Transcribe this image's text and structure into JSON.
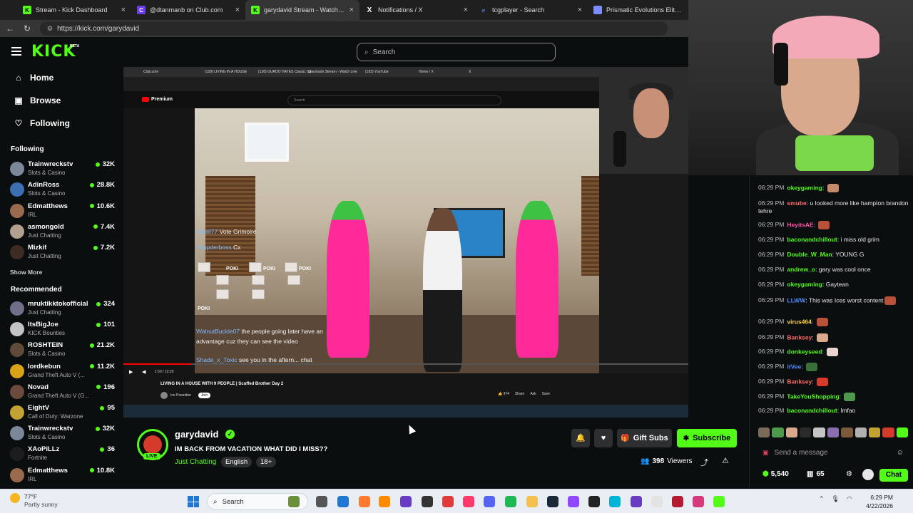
{
  "browser": {
    "tabs": [
      {
        "label": "Stream - Kick Dashboard",
        "icon": "kick-icon",
        "color": "#53fc18",
        "active": false
      },
      {
        "label": "@dtanmanb on Club.com",
        "icon": "club-icon",
        "color": "#6b3cf2",
        "active": false
      },
      {
        "label": "garydavid Stream - Watch Live on",
        "icon": "kick-icon",
        "color": "#53fc18",
        "active": true
      },
      {
        "label": "Notifications / X",
        "icon": "x-icon",
        "color": "#ffffff",
        "active": false
      },
      {
        "label": "tcgplayer - Search",
        "icon": "search-icon",
        "color": "#4f8cff",
        "active": false
      },
      {
        "label": "Prismatic Evolutions Elite Trainer B",
        "icon": "store-icon",
        "color": "#7a8cff",
        "active": false
      }
    ],
    "url": "https://kick.com/garydavid"
  },
  "kick": {
    "logo": "KICK",
    "beta": "BETA",
    "search_placeholder": "Search"
  },
  "sidebar": {
    "nav": [
      {
        "label": "Home",
        "icon": "home-icon"
      },
      {
        "label": "Browse",
        "icon": "browse-icon"
      },
      {
        "label": "Following",
        "icon": "heart-icon"
      }
    ],
    "following_heading": "Following",
    "following": [
      {
        "name": "Trainwreckstv",
        "category": "Slots & Casino",
        "viewers": "32K",
        "color": "#7a8899"
      },
      {
        "name": "AdinRoss",
        "category": "Slots & Casino",
        "viewers": "28.8K",
        "color": "#3b6fb0"
      },
      {
        "name": "Edmatthews",
        "category": "IRL",
        "viewers": "10.6K",
        "color": "#9a6a4e"
      },
      {
        "name": "asmongold",
        "category": "Just Chatting",
        "viewers": "7.4K",
        "color": "#b2a18c"
      },
      {
        "name": "Mizkif",
        "category": "Just Chatting",
        "viewers": "7.2K",
        "color": "#3e2b24"
      }
    ],
    "show_more": "Show More",
    "recommended_heading": "Recommended",
    "recommended": [
      {
        "name": "mruktikktokofficial",
        "category": "Just Chatting",
        "viewers": "324",
        "color": "#6f6f8a"
      },
      {
        "name": "ItsBigJoe",
        "category": "KICK Bounties",
        "viewers": "101",
        "color": "#c4c4c4"
      },
      {
        "name": "ROSHTEIN",
        "category": "Slots & Casino",
        "viewers": "21.2K",
        "color": "#5f4a3a"
      },
      {
        "name": "lordkebun",
        "category": "Grand Theft Auto V (...",
        "viewers": "11.2K",
        "color": "#d8a317"
      },
      {
        "name": "Novad",
        "category": "Grand Theft Auto V (G...",
        "viewers": "196",
        "color": "#6a4b3c"
      },
      {
        "name": "EightV",
        "category": "Call of Duty: Warzone",
        "viewers": "95",
        "color": "#c2a233"
      },
      {
        "name": "Trainwreckstv",
        "category": "Slots & Casino",
        "viewers": "32K",
        "color": "#7a8899"
      },
      {
        "name": "XAoPiLLz",
        "category": "Fortnite",
        "viewers": "36",
        "color": "#1d1d1d"
      },
      {
        "name": "Edmatthews",
        "category": "IRL",
        "viewers": "10.8K",
        "color": "#9a6a4e"
      }
    ]
  },
  "video": {
    "inner_tabs": [
      "Club.com",
      "(128) LIVING IN A HOUSE",
      "(128) GURDO HATES Classic Cy",
      "dtanmanb Stream - Watch Live",
      "(193) YouTube",
      "Home / X",
      "X"
    ],
    "yt_logo": "Premium",
    "yt_search": "Search",
    "overlay_chat": [
      {
        "user": "Kahlil77",
        "text": "Vote Grimoire"
      },
      {
        "user": "Asapderboss",
        "text": "Cx"
      },
      {
        "user": "WalnutBuckle07",
        "text": "the people going later have an"
      },
      {
        "user": "",
        "text": "advantage cuz they can see the video"
      },
      {
        "user": "Shade_x_Toxic",
        "text": "see you in the aftern... chat"
      }
    ],
    "poki_label": "POKI",
    "time_display": "1:59 / 13:29",
    "yt_title": "LIVING IN A HOUSE WITH 9 PEOPLE | Scuffed Brother Day 2",
    "yt_channel": "Ice Poseidon",
    "yt_join": "Join",
    "yt_likes": "974",
    "yt_share": "Share",
    "yt_ask": "Ask",
    "yt_save": "Save",
    "progress_fraction": 0.12
  },
  "stream": {
    "streamer": "garydavid",
    "live": "LIVE",
    "title": "IM BACK FROM VACATION WHAT DID I MISS??",
    "category": "Just Chatting",
    "tags": [
      "English",
      "18+"
    ],
    "gift_label": "Gift Subs",
    "subscribe_label": "Subscribe",
    "viewers": "398",
    "viewers_label": "Viewers"
  },
  "chat": {
    "messages": [
      {
        "time": "06:29 PM",
        "user": "okeygaming",
        "user_color": "#53fc18",
        "text": "",
        "emote_color": "#c48a6a"
      },
      {
        "time": "06:29 PM",
        "user": "smube",
        "user_color": "#ff6b6b",
        "text": "u looked more like hampton brandon tehre",
        "emote_color": ""
      },
      {
        "time": "06:29 PM",
        "user": "HeyitsAE",
        "user_color": "#ff4fa3",
        "text": "",
        "emote_color": "#b8513a"
      },
      {
        "time": "06:29 PM",
        "user": "baconandchillout",
        "user_color": "#53fc18",
        "text": "i miss old grim",
        "emote_color": ""
      },
      {
        "time": "06:29 PM",
        "user": "Double_W_Man",
        "user_color": "#53fc18",
        "text": "YOUNG G",
        "emote_color": ""
      },
      {
        "time": "06:29 PM",
        "user": "andrew_o",
        "user_color": "#53fc18",
        "text": "gary was cool once",
        "emote_color": ""
      },
      {
        "time": "06:29 PM",
        "user": "okeygaming",
        "user_color": "#53fc18",
        "text": "Gaytean",
        "emote_color": ""
      },
      {
        "time": "06:29 PM",
        "user": "LLWW",
        "user_color": "#4f8cff",
        "text": "This was Ices worst content",
        "emote_color": "#b8513a"
      },
      {
        "time": "06:29 PM",
        "user": "virus464",
        "user_color": "#ffd23f",
        "text": "",
        "emote_color": "#b8513a"
      },
      {
        "time": "06:29 PM",
        "user": "Banksey",
        "user_color": "#ff6b6b",
        "text": "",
        "emote_color": "#d9a98e"
      },
      {
        "time": "06:29 PM",
        "user": "donkeyseed",
        "user_color": "#53fc18",
        "text": "",
        "emote_color": "#e9d4cf"
      },
      {
        "time": "06:29 PM",
        "user": "itVee",
        "user_color": "#4f8cff",
        "text": "",
        "emote_color": "#3a6f3a"
      },
      {
        "time": "06:29 PM",
        "user": "Banksey",
        "user_color": "#ff6b6b",
        "text": "",
        "emote_color": "#d63a2a"
      },
      {
        "time": "06:29 PM",
        "user": "TakeYouShopping",
        "user_color": "#53fc18",
        "text": "",
        "emote_color": "#4d9a4d"
      },
      {
        "time": "06:29 PM",
        "user": "baconandchillout",
        "user_color": "#53fc18",
        "text": "lmfao",
        "emote_color": ""
      }
    ],
    "input_placeholder": "Send a message",
    "kicks": "5,540",
    "points": "65",
    "chat_button": "Chat"
  },
  "taskbar": {
    "temperature": "77°F",
    "condition": "Partly sunny",
    "search": "Search",
    "time": "6:29 PM",
    "date": "4/22/2026"
  }
}
